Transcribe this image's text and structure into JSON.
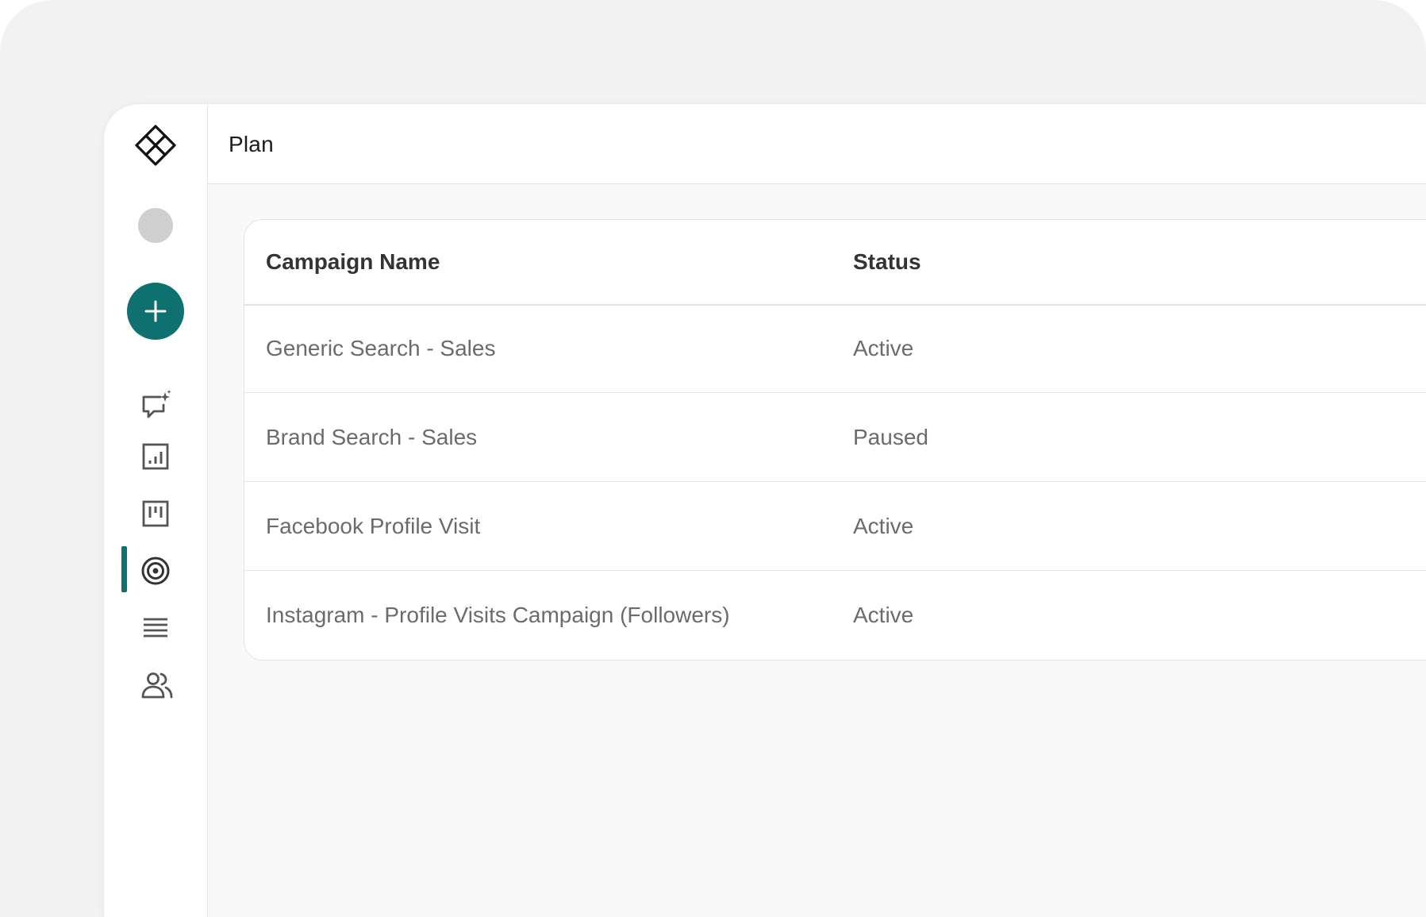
{
  "app": {
    "page_title": "Plan"
  },
  "sidebar": {
    "add_button_label": "+",
    "nav_items": [
      {
        "icon": "chat-sparkle-icon",
        "active": false
      },
      {
        "icon": "bar-chart-icon",
        "active": false
      },
      {
        "icon": "board-icon",
        "active": false
      },
      {
        "icon": "target-icon",
        "active": true
      },
      {
        "icon": "list-icon",
        "active": false
      },
      {
        "icon": "users-icon",
        "active": false
      }
    ]
  },
  "table": {
    "columns": [
      "Campaign Name",
      "Status"
    ],
    "rows": [
      {
        "name": "Generic Search - Sales",
        "status": "Active"
      },
      {
        "name": "Brand Search - Sales",
        "status": "Paused"
      },
      {
        "name": "Facebook Profile Visit",
        "status": "Active"
      },
      {
        "name": "Instagram - Profile Visits Campaign (Followers)",
        "status": "Active"
      }
    ]
  },
  "colors": {
    "accent": "#0e7170",
    "background": "#f2f2f2",
    "text_primary": "#333333",
    "text_secondary": "#6b6b6b"
  }
}
